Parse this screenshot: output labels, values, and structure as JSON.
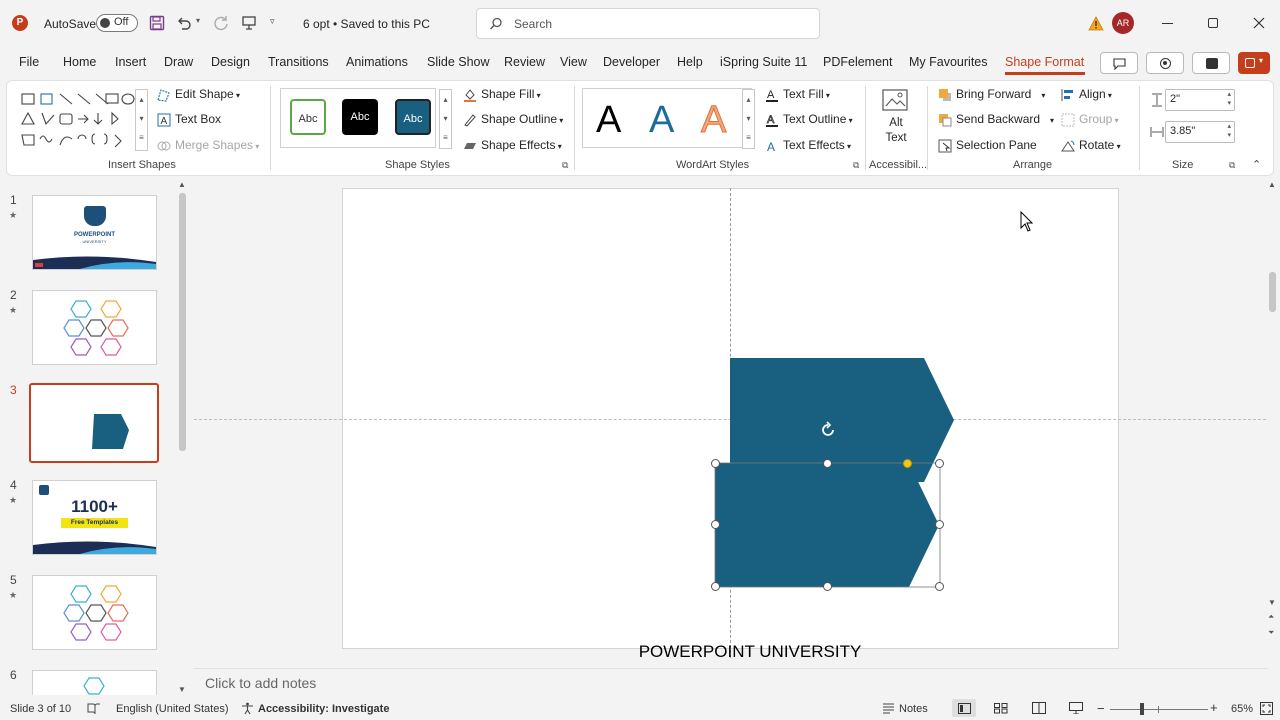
{
  "titlebar": {
    "autosave_label": "AutoSave",
    "autosave_state": "Off",
    "doc_title": "6 opt • Saved to this PC",
    "search_placeholder": "Search",
    "user_initials": "AR"
  },
  "menu": {
    "tabs": [
      "File",
      "Home",
      "Insert",
      "Draw",
      "Design",
      "Transitions",
      "Animations",
      "Slide Show",
      "Review",
      "View",
      "Developer",
      "Help",
      "iSpring Suite 11",
      "PDFelement",
      "My Favourites",
      "Shape Format"
    ],
    "active_tab": "Shape Format"
  },
  "ribbon": {
    "insert_shapes": {
      "label": "Insert Shapes",
      "edit_shape": "Edit Shape",
      "text_box": "Text Box",
      "merge_shapes": "Merge Shapes"
    },
    "shape_styles": {
      "label": "Shape Styles",
      "swatches": [
        "Abc",
        "Abc",
        "Abc"
      ],
      "shape_fill": "Shape Fill",
      "shape_outline": "Shape Outline",
      "shape_effects": "Shape Effects"
    },
    "wordart_styles": {
      "label": "WordArt Styles",
      "letters": [
        "A",
        "A",
        "A"
      ],
      "text_fill": "Text Fill",
      "text_outline": "Text Outline",
      "text_effects": "Text Effects"
    },
    "accessibility": {
      "label": "Accessibil...",
      "alt_text_line1": "Alt",
      "alt_text_line2": "Text"
    },
    "arrange": {
      "label": "Arrange",
      "bring_forward": "Bring Forward",
      "send_backward": "Send Backward",
      "selection_pane": "Selection Pane",
      "align": "Align",
      "group": "Group",
      "rotate": "Rotate"
    },
    "size": {
      "label": "Size",
      "height": "2\"",
      "width": "3.85\""
    }
  },
  "slides": [
    {
      "number": "1",
      "star": "★"
    },
    {
      "number": "2",
      "star": "★"
    },
    {
      "number": "3",
      "star": ""
    },
    {
      "number": "4",
      "star": "★"
    },
    {
      "number": "5",
      "star": "★"
    },
    {
      "number": "6",
      "star": ""
    }
  ],
  "thumb_text": {
    "slide1_line1": "POWERPOINT",
    "slide1_line2": "UNIVERSITY",
    "slide4_big": "1100+",
    "slide4_sub": "Free Templates"
  },
  "slide": {
    "footer_text": "POWERPOINT UNIVERSITY",
    "shape_color": "#195f7f"
  },
  "notes_placeholder": "Click to add notes",
  "statusbar": {
    "slide_info": "Slide 3 of 10",
    "language": "English (United States)",
    "accessibility": "Accessibility: Investigate",
    "notes": "Notes",
    "zoom": "65%"
  },
  "colors": {
    "accent": "#c43e1c",
    "shape_teal": "#195f7f"
  }
}
